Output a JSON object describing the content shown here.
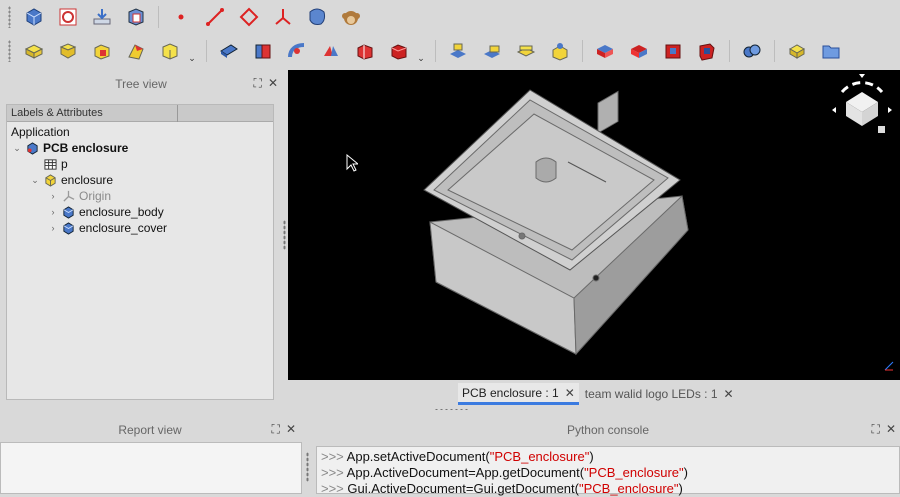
{
  "colors": {
    "accent": "#3b7be0",
    "viewport_bg": "#000000",
    "string_red": "#d00000"
  },
  "toolbar_row1": [
    "part-icon",
    "sketch-icon",
    "import-icon",
    "new-body-icon",
    "point-icon",
    "line-icon",
    "polygon-icon",
    "axes-icon",
    "blob-icon",
    "monkey-icon"
  ],
  "toolbar_row2": [
    "box-icon",
    "cylinder-icon",
    "cone-icon",
    "prism-icon",
    "wedge-icon",
    "shape-builder-icon",
    "extrude-icon",
    "revolve-icon",
    "mirror-icon",
    "fillet-icon",
    "chamfer-icon",
    "face-icon",
    "section-icon",
    "loft-icon",
    "sweep-icon",
    "compound-icon",
    "explode-icon",
    "boolean-icon",
    "cut-icon",
    "fuse-icon",
    "common-icon",
    "join-icon",
    "checker-icon",
    "part-design-icon",
    "folder-icon"
  ],
  "tree_panel": {
    "title": "Tree view",
    "header": "Labels & Attributes",
    "root": "Application",
    "items": [
      {
        "label": "PCB enclosure",
        "bold": true,
        "indent": 0,
        "arrow": "⌄",
        "icon": "document-icon"
      },
      {
        "label": "p",
        "bold": false,
        "indent": 1,
        "arrow": "",
        "icon": "spreadsheet-icon"
      },
      {
        "label": "enclosure",
        "bold": false,
        "indent": 1,
        "arrow": "⌄",
        "icon": "part-container-icon"
      },
      {
        "label": "Origin",
        "bold": false,
        "indent": 2,
        "arrow": "›",
        "icon": "origin-icon",
        "grey": true
      },
      {
        "label": "enclosure_body",
        "bold": false,
        "indent": 2,
        "arrow": "›",
        "icon": "body-icon"
      },
      {
        "label": "enclosure_cover",
        "bold": false,
        "indent": 2,
        "arrow": "›",
        "icon": "body-icon"
      }
    ]
  },
  "tabs": [
    {
      "label": "PCB enclosure : 1",
      "active": true,
      "close": "✕"
    },
    {
      "label": "team walid logo LEDs : 1",
      "active": false,
      "close": "✕"
    }
  ],
  "report_panel": {
    "title": "Report view"
  },
  "python_panel": {
    "title": "Python console",
    "lines": [
      {
        "prompt": ">>>",
        "code": "App.setActiveDocument(",
        "str": "\"PCB_enclosure\"",
        "end": ")"
      },
      {
        "prompt": ">>>",
        "code": "App.ActiveDocument=App.getDocument(",
        "str": "\"PCB_enclosure\"",
        "end": ")"
      },
      {
        "prompt": ">>>",
        "code": "Gui.ActiveDocument=Gui.getDocument(",
        "str": "\"PCB_enclosure\"",
        "end": ")"
      }
    ]
  },
  "panel_controls": {
    "float": "⛶",
    "close": "✕"
  }
}
